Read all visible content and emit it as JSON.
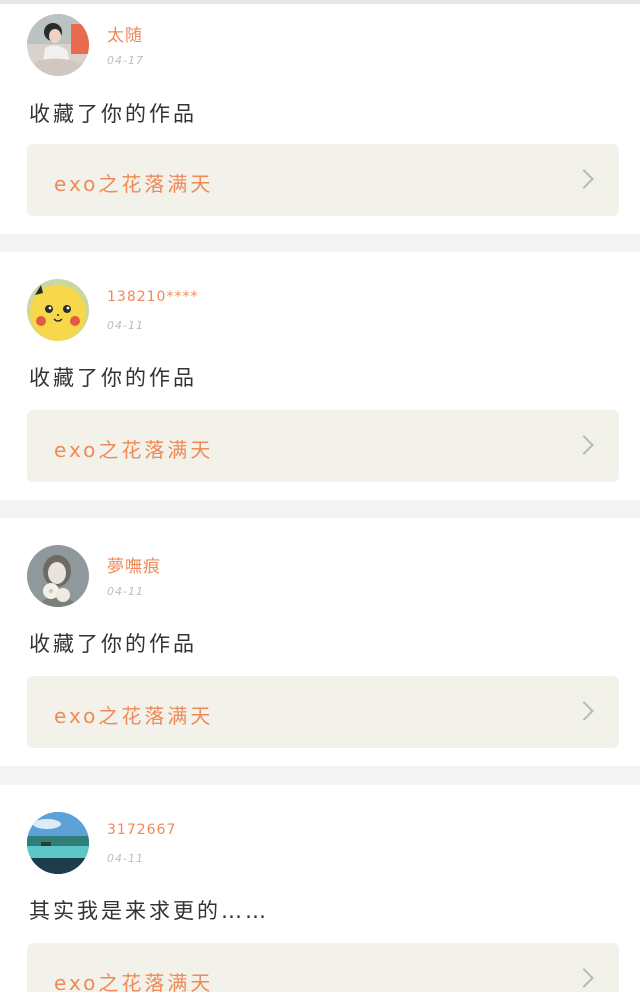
{
  "notifications": [
    {
      "username": "太随",
      "date": "04-17",
      "message": "收藏了你的作品",
      "work_title": "exo之花落满天",
      "avatar": "girl-photo-avatar"
    },
    {
      "username": "138210****",
      "date": "04-11",
      "message": "收藏了你的作品",
      "work_title": "exo之花落满天",
      "avatar": "pikachu-avatar"
    },
    {
      "username": "夢嘸痕",
      "date": "04-11",
      "message": "收藏了你的作品",
      "work_title": "exo之花落满天",
      "avatar": "flower-girl-avatar"
    },
    {
      "username": "3172667",
      "date": "04-11",
      "message": "其实我是来求更的……",
      "work_title": "exo之花落满天",
      "avatar": "beach-landscape-avatar"
    }
  ],
  "icons": {
    "chevron": "chevron-right-icon"
  },
  "colors": {
    "accent": "#ef8a58",
    "link_bg": "#f2f2ea",
    "separator": "#f4f4f4"
  }
}
